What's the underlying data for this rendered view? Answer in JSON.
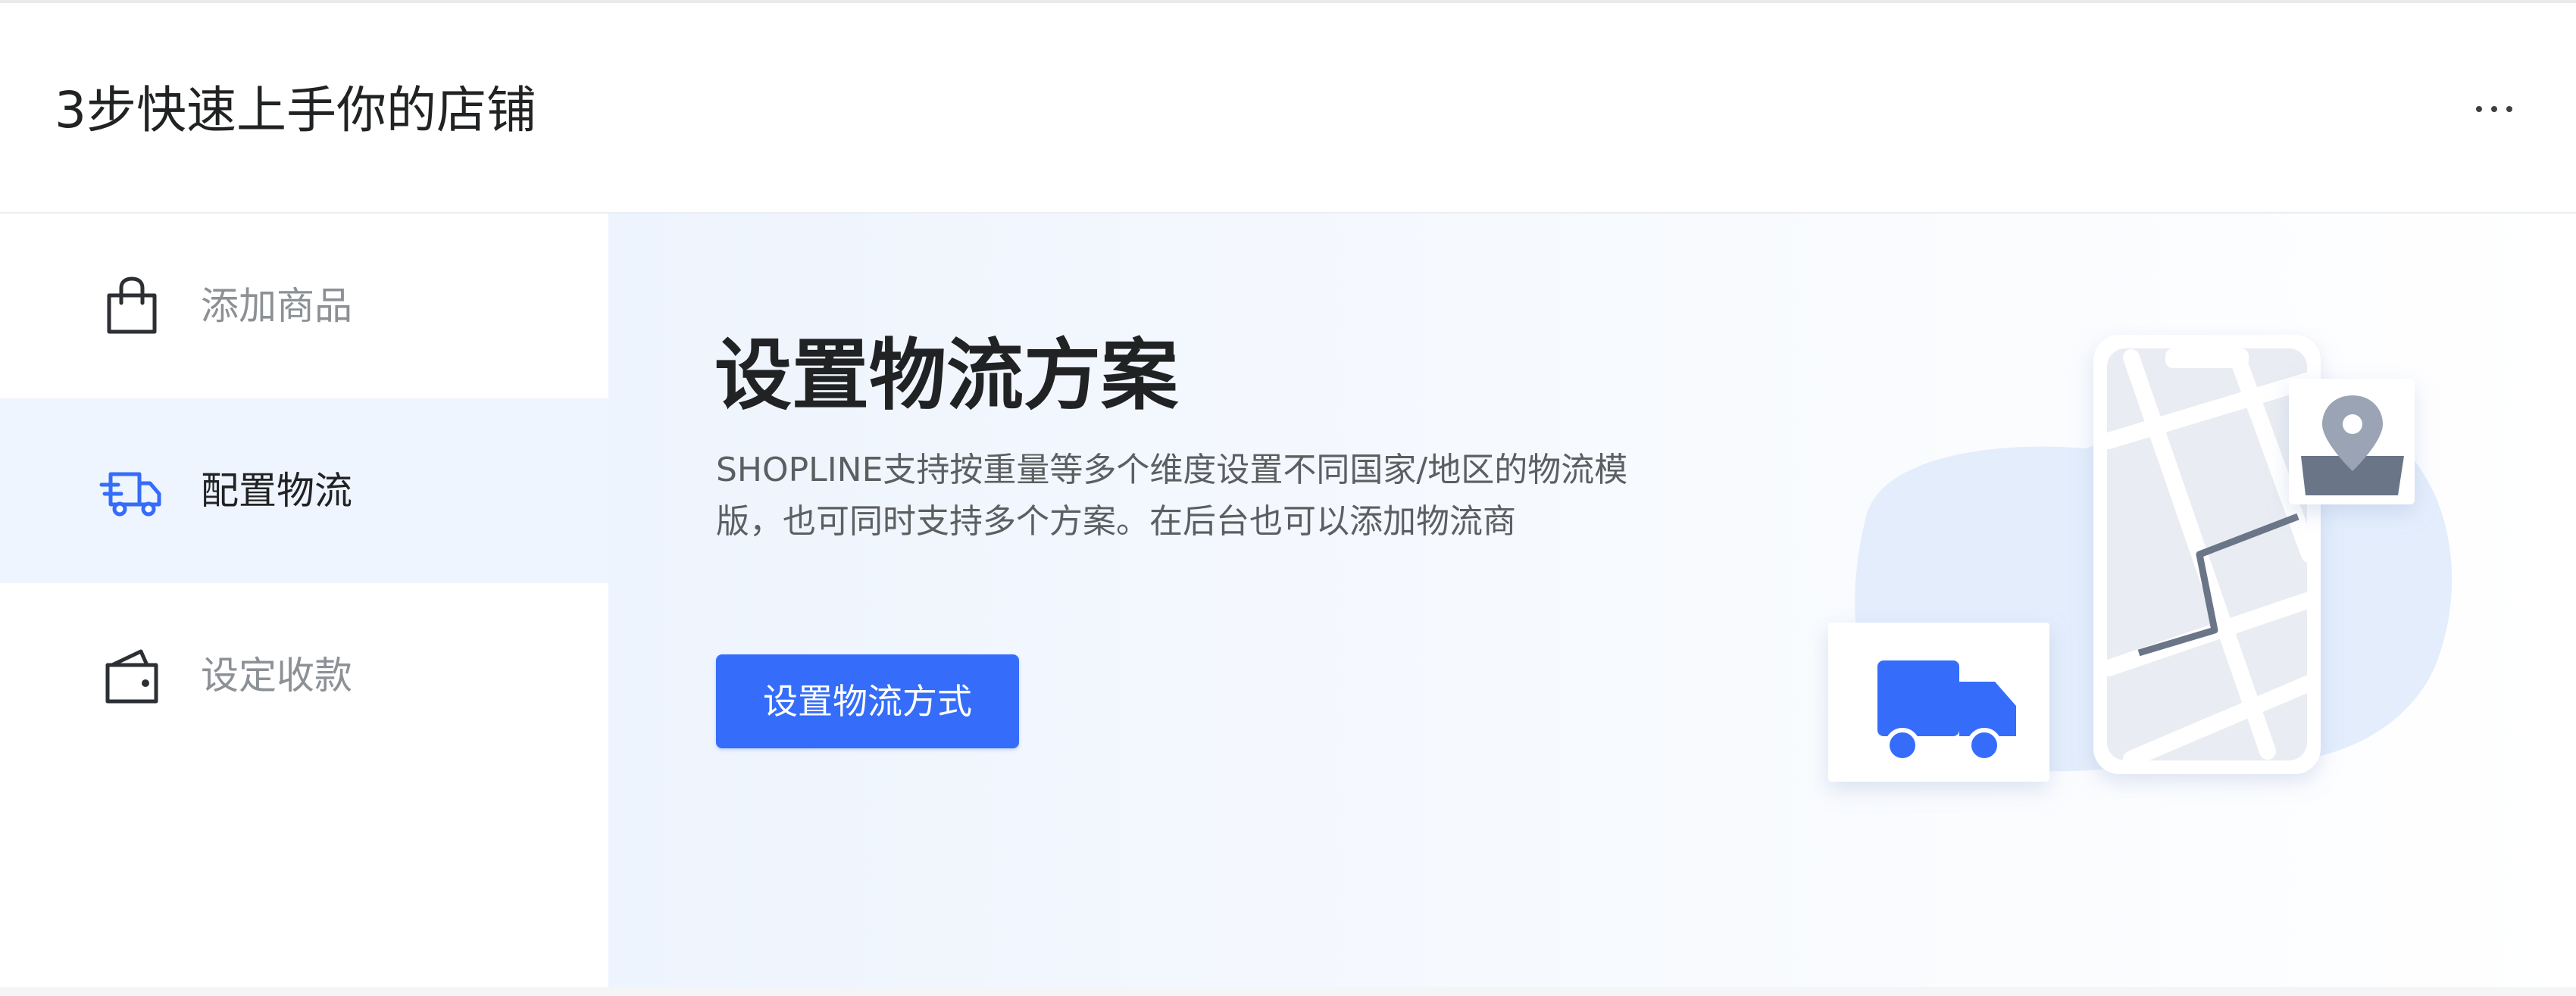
{
  "header": {
    "title": "3步快速上手你的店铺",
    "more_icon": "more-horizontal-icon"
  },
  "sidebar": {
    "steps": [
      {
        "label": "添加商品",
        "icon": "shopping-bag-icon",
        "active": false
      },
      {
        "label": "配置物流",
        "icon": "delivery-truck-icon",
        "active": true
      },
      {
        "label": "设定收款",
        "icon": "wallet-icon",
        "active": false
      }
    ]
  },
  "main": {
    "heading": "设置物流方案",
    "description_lines": [
      "SHOPLINE支持按重量等多个维度设置不同国家/地区的物流模",
      "版，也可同时支持多个方案。在后台也可以添加物流商"
    ],
    "button_label": "设置物流方式",
    "illustration": "phone-map-truck-illustration"
  },
  "colors": {
    "accent": "#356dfa",
    "active_bg": "#eef5fe",
    "text_primary": "#202223",
    "text_muted": "#8c9196"
  }
}
